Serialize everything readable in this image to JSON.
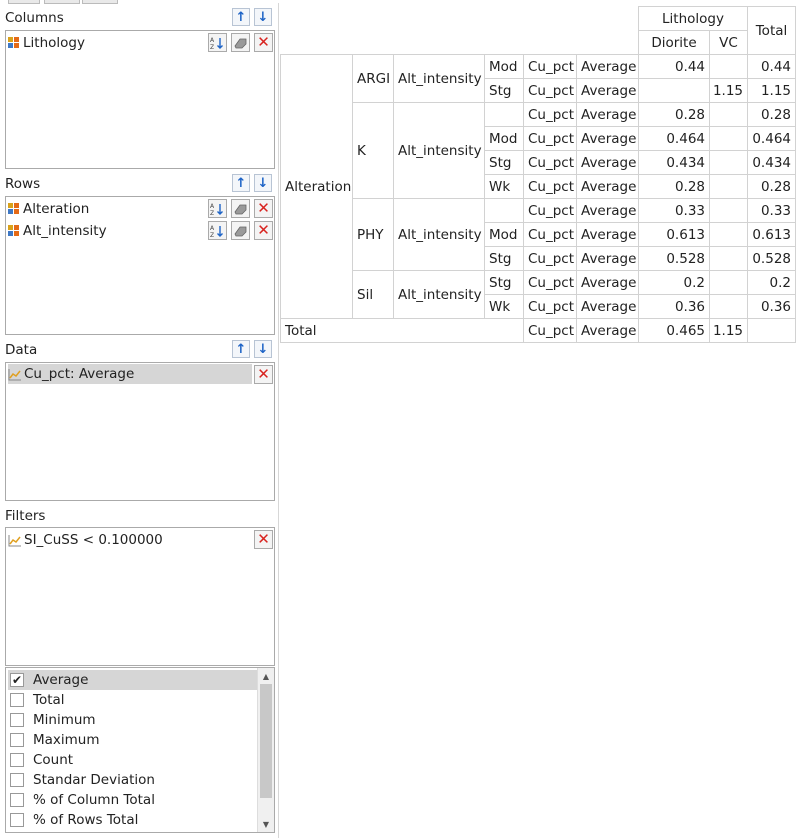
{
  "sections": {
    "columns": {
      "title": "Columns",
      "items": [
        "Lithology"
      ]
    },
    "rows": {
      "title": "Rows",
      "items": [
        "Alteration",
        "Alt_intensity"
      ]
    },
    "data": {
      "title": "Data",
      "items": [
        "Cu_pct: Average"
      ]
    },
    "filters": {
      "title": "Filters",
      "items": [
        "SI_CuSS < 0.100000"
      ]
    }
  },
  "aggregations": {
    "items": [
      {
        "label": "Average",
        "checked": true
      },
      {
        "label": "Total",
        "checked": false
      },
      {
        "label": "Minimum",
        "checked": false
      },
      {
        "label": "Maximum",
        "checked": false
      },
      {
        "label": "Count",
        "checked": false
      },
      {
        "label": "Standar Deviation",
        "checked": false
      },
      {
        "label": "% of Column Total",
        "checked": false
      },
      {
        "label": "% of Rows Total",
        "checked": false
      }
    ]
  },
  "icons": {
    "up": "arrow-up-icon",
    "down": "arrow-down-icon",
    "sort": "sort-az-icon",
    "eraser": "eraser-icon",
    "delete": "delete-icon",
    "field": "field-icon",
    "measure": "measure-chart-icon"
  },
  "colors": {
    "arrow": "#1d63c6",
    "delete": "#d8231f",
    "selection": "#d6d6d6"
  },
  "pivot": {
    "col_header": "Lithology",
    "col_values": [
      "Diorite",
      "VC"
    ],
    "total_label": "Total",
    "row_field_label": "Alteration",
    "sub_field_label": "Alt_intensity",
    "measure": "Cu_pct",
    "agg": "Average",
    "groups": [
      {
        "name": "ARGI",
        "rows": [
          {
            "intensity": "Mod",
            "diorite": "0.44",
            "vc": "",
            "total": "0.44"
          },
          {
            "intensity": "Stg",
            "diorite": "",
            "vc": "1.15",
            "total": "1.15"
          }
        ]
      },
      {
        "name": "K",
        "rows": [
          {
            "intensity": "",
            "diorite": "0.28",
            "vc": "",
            "total": "0.28"
          },
          {
            "intensity": "Mod",
            "diorite": "0.464",
            "vc": "",
            "total": "0.464"
          },
          {
            "intensity": "Stg",
            "diorite": "0.434",
            "vc": "",
            "total": "0.434"
          },
          {
            "intensity": "Wk",
            "diorite": "0.28",
            "vc": "",
            "total": "0.28"
          }
        ]
      },
      {
        "name": "PHY",
        "rows": [
          {
            "intensity": "",
            "diorite": "0.33",
            "vc": "",
            "total": "0.33"
          },
          {
            "intensity": "Mod",
            "diorite": "0.613",
            "vc": "",
            "total": "0.613"
          },
          {
            "intensity": "Stg",
            "diorite": "0.528",
            "vc": "",
            "total": "0.528"
          }
        ]
      },
      {
        "name": "Sil",
        "rows": [
          {
            "intensity": "Stg",
            "diorite": "0.2",
            "vc": "",
            "total": "0.2"
          },
          {
            "intensity": "Wk",
            "diorite": "0.36",
            "vc": "",
            "total": "0.36"
          }
        ]
      }
    ],
    "grand_total": {
      "label": "Total",
      "diorite": "0.465",
      "vc": "1.15",
      "total": ""
    }
  }
}
